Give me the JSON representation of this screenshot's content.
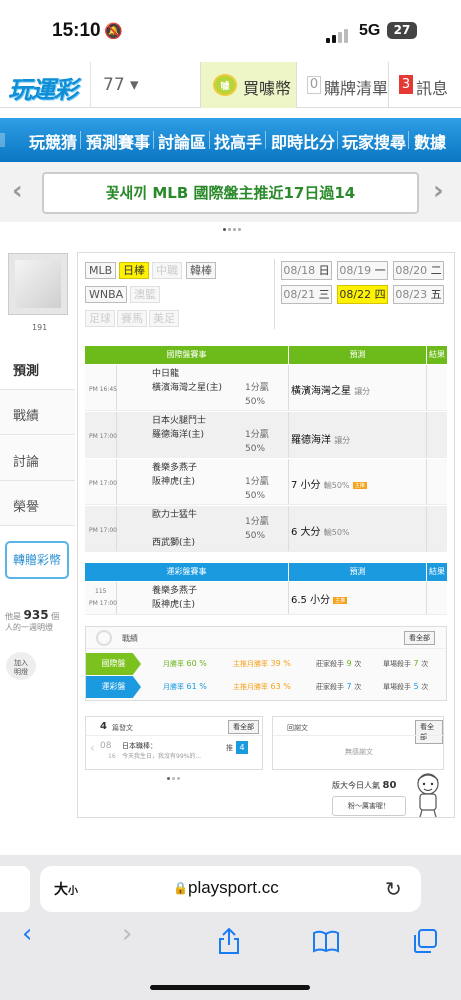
{
  "status": {
    "time": "15:10",
    "network": "5G",
    "battery": "27"
  },
  "header": {
    "logo": "玩運彩",
    "user_id": "77 ▾",
    "buy_label": "買噱幣",
    "list_count": "0",
    "list_label": "購牌清單",
    "msg_count": "3",
    "msg_label": "訊息",
    "coin_icon_text": "噱"
  },
  "nav": {
    "items": [
      "玩競猜",
      "預測賽事",
      "討論區",
      "找高手",
      "即時比分",
      "玩家搜尋",
      "數據"
    ]
  },
  "banner": {
    "text": "꽃새끼 MLB 國際盤主推近17日過14",
    "left_arrow": "‹",
    "right_arrow": "›"
  },
  "profile": {
    "user_name": "191",
    "menu": [
      "預測",
      "戰績",
      "討論",
      "榮譽"
    ],
    "transfer": "轉贈彩幣",
    "fans_prefix": "他是",
    "fans_count": "935",
    "fans_suffix": "個",
    "fans_line2": "人的一週明燈",
    "follow_btn": "加入\n明燈"
  },
  "filters": {
    "sports": [
      {
        "label": "MLB",
        "state": "normal"
      },
      {
        "label": "日棒",
        "state": "active"
      },
      {
        "label": "中職",
        "state": "dim"
      },
      {
        "label": "韓棒",
        "state": "normal"
      },
      {
        "label": "WNBA",
        "state": "normal"
      },
      {
        "label": "澳籃",
        "state": "dim"
      },
      {
        "label": "足球",
        "state": "dim"
      },
      {
        "label": "賽馬",
        "state": "dim"
      },
      {
        "label": "美足",
        "state": "dim"
      }
    ],
    "dates": [
      {
        "date": "08/18",
        "wd": "日",
        "on": false
      },
      {
        "date": "08/19",
        "wd": "一",
        "on": false
      },
      {
        "date": "08/20",
        "wd": "二",
        "on": false
      },
      {
        "date": "08/21",
        "wd": "三",
        "on": false
      },
      {
        "date": "08/22",
        "wd": "四",
        "on": true
      },
      {
        "date": "08/23",
        "wd": "五",
        "on": false
      }
    ]
  },
  "intl": {
    "head": {
      "games": "國際盤賽事",
      "pred": "預測",
      "result": "結果"
    },
    "rows": [
      {
        "time": "PM 16:45",
        "teams": [
          "中日龍",
          "橫濱海灣之星(主)"
        ],
        "line": [
          "1分贏",
          "50%"
        ],
        "pick": "橫濱海灣之星",
        "sub": "讓分",
        "tag": ""
      },
      {
        "time": "PM 17:00",
        "teams": [
          "日本火腿鬥士",
          "羅德海洋(主)"
        ],
        "line": [
          "1分贏",
          "50%"
        ],
        "pick": "羅德海洋",
        "sub": "讓分",
        "tag": ""
      },
      {
        "time": "PM 17:00",
        "teams": [
          "養樂多燕子",
          "阪神虎(主)"
        ],
        "line": [
          "1分贏",
          "50%"
        ],
        "pick": "7 小分",
        "sub": "輸50%",
        "tag": "主推"
      },
      {
        "time": "PM 17:00",
        "teams": [
          "歐力士猛牛",
          "西武獅(主)"
        ],
        "line": [
          "1分贏",
          "50%"
        ],
        "pick": "6 大分",
        "sub": "輸50%",
        "tag": ""
      }
    ]
  },
  "local": {
    "head": {
      "games": "運彩盤賽事",
      "pred": "預測",
      "result": "結果"
    },
    "rows": [
      {
        "time": [
          "115",
          "PM 17:00"
        ],
        "teams": [
          "養樂多燕子",
          "阪神虎(主)"
        ],
        "pick": "6.5 小分",
        "tag": "主推"
      }
    ]
  },
  "record": {
    "title": "戰績",
    "all": "看全部",
    "rows": [
      {
        "label": "國際盤",
        "rate_label": "月勝率",
        "rate": "60 %",
        "main_label": "主推月勝率",
        "main": "39 %",
        "streak_label": "莊家殺手",
        "streak": "9",
        "streak_unit": "次",
        "single_label": "單場殺手",
        "single": "7",
        "single_unit": "次",
        "color": "#7cc21f"
      },
      {
        "label": "運彩盤",
        "rate_label": "月勝率",
        "rate": "61 %",
        "main_label": "主推月勝率",
        "main": "63 %",
        "streak_label": "莊家殺手",
        "streak": "7",
        "streak_unit": "次",
        "single_label": "單場殺手",
        "single": "5",
        "single_unit": "次",
        "color": "#1b9ae0"
      }
    ]
  },
  "articles": {
    "count": "4",
    "title": "篇發文",
    "all": "看全部",
    "month": "08",
    "day": "16",
    "post_title": "日本職棒：",
    "post_text": "今天我生日，我沒有99%的...",
    "push_label": "推",
    "push": "4",
    "reply_title": "回謝文",
    "reply_all": "看全部",
    "reply_empty": "無感謝文"
  },
  "popularity": {
    "label": "版大今日人氣",
    "value": "80",
    "bubble": "粉～厲害喔！"
  },
  "safari": {
    "aa": "大",
    "aa_small": "小",
    "url": "playsport.cc"
  }
}
